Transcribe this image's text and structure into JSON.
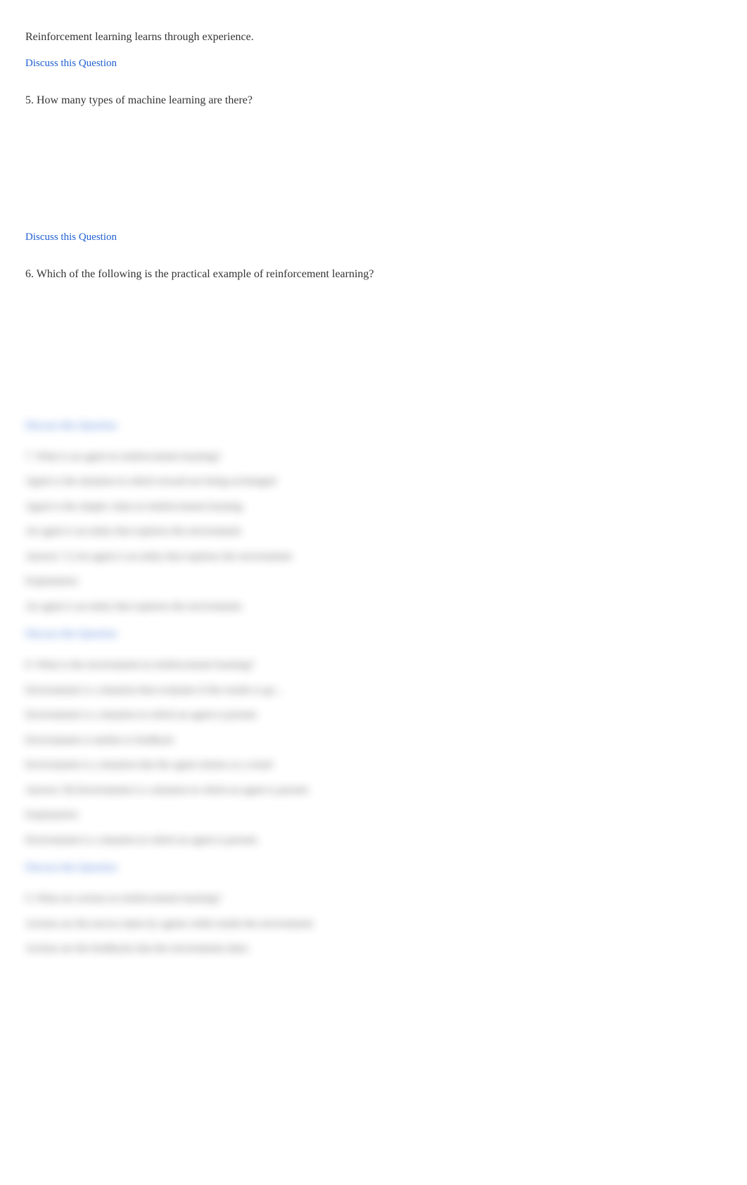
{
  "intro_statement": "Reinforcement learning learns through experience.",
  "discuss_label": "Discuss this Question",
  "q5": {
    "title": "5. How many types of machine learning are there?"
  },
  "q6": {
    "title": "6. Which of the following is the practical example of reinforcement learning?"
  },
  "blurred": {
    "q7": {
      "title": "7. What is an agent in reinforcement learning?",
      "opt1": "Agent is the situation in which reward are being exchanged",
      "opt2": "Agent is the simple value in reinforcement learning",
      "opt3": "An agent is an entity that explores the environment",
      "answer_label": "Answer: C) An agent is an entity that explores the environment",
      "explanation_label": "Explanation:",
      "explanation": "An agent is an entity that explores the environment.",
      "discuss": "Discuss this Question"
    },
    "q8": {
      "title": "8. What is the environment in reinforcement learning?",
      "opt1": "Environment is a situation that evaluates if the results is go...",
      "opt2": "Environment is a situation in which an agent is present",
      "opt3": "Environment is similar to feedback",
      "opt4": "Environment is a situation that the agent returns as a result",
      "answer_label": "Answer: B) Environment is a situation in which an agent is present",
      "explanation_label": "Explanation:",
      "explanation": "Environment is a situation in which an agent is present.",
      "discuss": "Discuss this Question"
    },
    "q9": {
      "title": "9. What are actions in reinforcement learning?",
      "opt1": "Actions are the moves taken by agents while inside the environment",
      "opt2": "Actions are the feedbacks that the environment takes"
    }
  }
}
